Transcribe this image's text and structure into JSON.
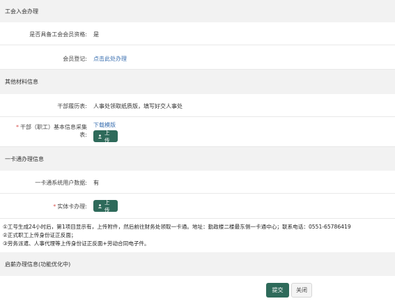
{
  "sections": {
    "union": "工会入会办理",
    "other_materials": "其他材料信息",
    "card": "一卡通办理信息",
    "salary": "启薪办理信息(功能优化中)"
  },
  "union": {
    "qualification_label": "是否具备工会会员资格:",
    "qualification_value": "是",
    "registration_label": "会员登记:",
    "registration_link": "点击此处办理"
  },
  "materials": {
    "resume_label": "干部履历表:",
    "resume_value": "人事处领取纸质版，填写好交人事处",
    "basic_info_label_line1": "干部（职工）基本信息采集",
    "basic_info_label_line2": "表:",
    "required_mark": "*",
    "download_link": "下载模版",
    "upload_label": "上传"
  },
  "card": {
    "system_data_label": "一卡通系统用户数据:",
    "system_data_value": "有",
    "physical_card_label": "实体卡办理:",
    "required_mark": "*",
    "upload_label": "上传"
  },
  "notes": [
    "①工号生成24小时后，第1项目显示有，上传附件，然后前往财务处领取一卡通。地址：勤政楼二楼最东侧一卡通中心；联系电话：0551-65786419",
    "②正式职工上传身份证正反面；",
    "③劳务派遣、人事代理等上传身份证正反面+劳动合同电子件。"
  ],
  "footer": {
    "submit_label": "提交",
    "close_label": "关闭"
  },
  "colors": {
    "primary_button": "#2e6a5a",
    "link": "#3a6fb0",
    "required": "#d9534f",
    "section_bg": "#f2f2f2"
  }
}
